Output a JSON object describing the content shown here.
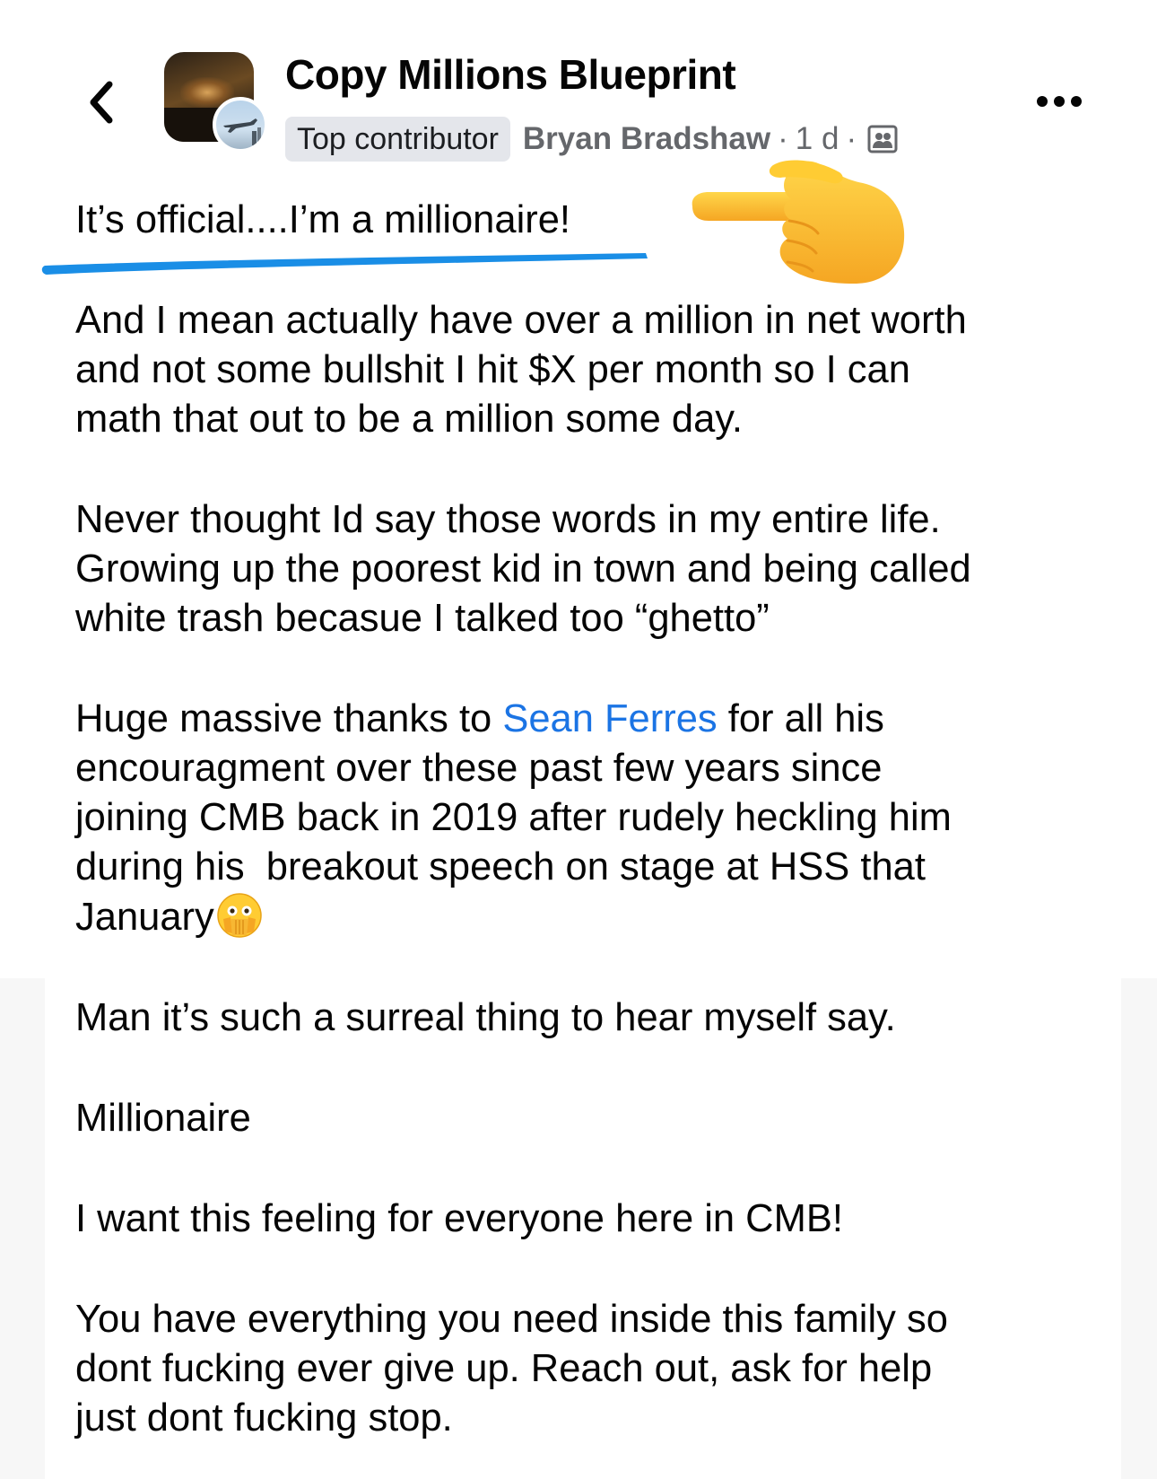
{
  "header": {
    "group_name": "Copy Millions Blueprint",
    "badge": "Top contributor",
    "author": "Bryan Bradshaw",
    "separator": "·",
    "time": "1 d",
    "audience_icon": "group-members-icon",
    "back_icon": "chevron-left-icon",
    "more_icon": "more-horizontal-icon"
  },
  "post": {
    "headline": "It’s official....I’m a millionaire!",
    "p1": [
      "And I mean actually have over a million in net worth",
      "and not some bullshit I hit $X per month so I can",
      "math that out to be a million some day."
    ],
    "p2": [
      "Never thought Id say those words in my entire life.",
      "Growing up the poorest kid in town and being called",
      "white trash becasue I talked too “ghetto”"
    ],
    "p3": {
      "before_mention": "Huge massive thanks to ",
      "mention": "Sean Ferres",
      "after_mention": " for all his",
      "lines": [
        "encouragment over these past few years since",
        "joining CMB back in 2019 after rudely heckling him",
        "during his  breakout speech on stage at HSS that"
      ],
      "last_line": "January"
    },
    "p4": "Man it’s such a surreal thing to hear myself say.",
    "p5": "Millionaire",
    "p6": "I want this feeling for everyone here in CMB!",
    "p7": [
      "You have everything you need inside this family so",
      "dont fucking ever give up. Reach out, ask for help",
      "just dont fucking stop."
    ]
  },
  "annotations": {
    "pointer_emoji": "backhand-index-pointing-left-emoji",
    "facepalm_emoji": "face-with-open-eyes-and-hand-over-mouth-emoji",
    "underline_color": "#1a8ee6"
  },
  "colors": {
    "text": "#050505",
    "secondary": "#65676b",
    "mention": "#1b74e4",
    "badge_bg": "#e4e6eb"
  }
}
